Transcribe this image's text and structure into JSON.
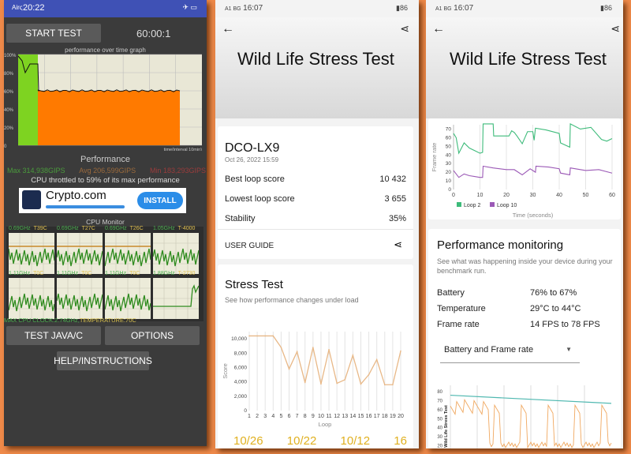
{
  "left": {
    "status": {
      "time": "20:22",
      "carrier": "Airς"
    },
    "start_button": "START TEST",
    "timer": "60:00:1",
    "graph_title": "performance over time graph",
    "graph_yticks": [
      "100%",
      "80%",
      "60%",
      "40%",
      "20%",
      "0"
    ],
    "graph_xlabel": "time(interval 10min)",
    "performance_label": "Performance",
    "max": "Max 314,938GIPS",
    "avg": "Avg 206,599GIPS",
    "min": "Min 183,293GIPS",
    "throttle_text": "CPU throttled to 59% of its max performance",
    "ad": {
      "brand": "Crypto.com",
      "install": "INSTALL"
    },
    "cpu_monitor_title": "CPU Monitor",
    "cores": [
      {
        "freq": "0.69GHz",
        "temp": "T39C"
      },
      {
        "freq": "0.69GHz",
        "temp": "T27C"
      },
      {
        "freq": "0.69GHz",
        "temp": "T26C"
      },
      {
        "freq": "1.05GHz",
        "temp": "T-4000"
      },
      {
        "freq": "1.11GHz",
        "temp": "T0C"
      },
      {
        "freq": "1.11GHz",
        "temp": "T0C"
      },
      {
        "freq": "1.11GHz",
        "temp": "T0C"
      },
      {
        "freq": "1.88GHz",
        "temp": "T-2730"
      }
    ],
    "max_cpu_clock": "MAX CPU CLOCK:2.74GHz,",
    "temperature": "TEMPERATURE:70C",
    "test_java_button": "TEST JAVA/C",
    "options_button": "OPTIONS",
    "help_button": "HELP/INSTRUCTIONS",
    "colors": {
      "high": "#7ed321",
      "throttled": "#ff7a00"
    }
  },
  "middle": {
    "status": {
      "carrier": "A1 BG",
      "time": "16:07",
      "battery": "86"
    },
    "title": "Wild Life Stress Test",
    "device": "DCO-LX9",
    "date": "Oct 26, 2022 15:59",
    "rows": [
      {
        "label": "Best loop score",
        "value": "10 432"
      },
      {
        "label": "Lowest loop score",
        "value": "3 655"
      },
      {
        "label": "Stability",
        "value": "35%"
      }
    ],
    "user_guide": "USER GUIDE",
    "stress_title": "Stress Test",
    "stress_subtitle": "See how performance changes under load",
    "bottom_partial": [
      "10/26",
      "10/22",
      "10/12",
      "16"
    ]
  },
  "right": {
    "status": {
      "carrier": "A1 BG",
      "time": "16:07",
      "battery": "86"
    },
    "title": "Wild Life Stress Test",
    "perf_title": "Performance monitoring",
    "perf_desc": "See what was happening inside your device during your benchmark run.",
    "rows": [
      {
        "label": "Battery",
        "value": "76% to 67%"
      },
      {
        "label": "Temperature",
        "value": "29°C to 44°C"
      },
      {
        "label": "Frame rate",
        "value": "14 FPS to 78 FPS"
      }
    ],
    "dropdown": "Battery and Frame rate",
    "bottom_chart_side_label": "Wild Life Stress Test",
    "bottom_chart_yticks": [
      "80",
      "70",
      "60",
      "50",
      "40",
      "30",
      "20",
      "10"
    ]
  },
  "chart_data": [
    {
      "type": "line",
      "xlabel": "Loop",
      "ylabel": "Score",
      "ylim": [
        0,
        11000
      ],
      "yticks": [
        "0",
        "2,000",
        "4,000",
        "6,000",
        "8,000",
        "10,000"
      ],
      "categories": [
        "1",
        "2",
        "3",
        "4",
        "5",
        "6",
        "7",
        "8",
        "9",
        "10",
        "11",
        "12",
        "13",
        "14",
        "15",
        "16",
        "17",
        "18",
        "19",
        "20"
      ],
      "values": [
        10400,
        10400,
        10400,
        10400,
        8800,
        5800,
        8200,
        3900,
        8800,
        3700,
        8500,
        3800,
        4300,
        7700,
        3700,
        5000,
        7100,
        3600,
        3600,
        8300
      ],
      "color": "#e8b887"
    },
    {
      "type": "line",
      "xlabel": "Time (seconds)",
      "ylabel": "Frame rate",
      "xlim": [
        0,
        60
      ],
      "ylim": [
        0,
        75
      ],
      "xticks": [
        "0",
        "10",
        "20",
        "30",
        "40",
        "50",
        "60"
      ],
      "yticks": [
        "0",
        "10",
        "20",
        "30",
        "40",
        "50",
        "60",
        "70"
      ],
      "legend": "bottom-left",
      "series": [
        {
          "name": "Loop 2",
          "color": "#3dbb7a",
          "x": [
            0,
            1,
            2,
            4,
            6,
            8,
            10,
            11,
            11.2,
            15,
            15.2,
            20,
            21,
            22,
            23,
            24,
            26,
            28,
            30,
            30.5,
            31,
            35,
            40,
            40.5,
            44,
            44.2,
            48,
            52,
            56,
            58,
            60
          ],
          "y": [
            65,
            60,
            42,
            54,
            48,
            45,
            42,
            43,
            76,
            76,
            62,
            62,
            62,
            68,
            66,
            62,
            53,
            67,
            67,
            57,
            71,
            69,
            65,
            54,
            49,
            76,
            70,
            72,
            58,
            56,
            59
          ]
        },
        {
          "name": "Loop 10",
          "color": "#9b59b6",
          "x": [
            0,
            2,
            4,
            6,
            8,
            10,
            11,
            11.2,
            15,
            20,
            23,
            26,
            29,
            31,
            31.2,
            36,
            40,
            40.5,
            44,
            44.2,
            50,
            55,
            60
          ],
          "y": [
            22,
            14,
            18,
            16,
            15,
            14,
            14,
            27,
            25,
            23,
            23,
            17,
            24,
            20,
            27,
            26,
            24,
            19,
            17,
            25,
            22,
            23,
            19
          ]
        }
      ]
    }
  ]
}
